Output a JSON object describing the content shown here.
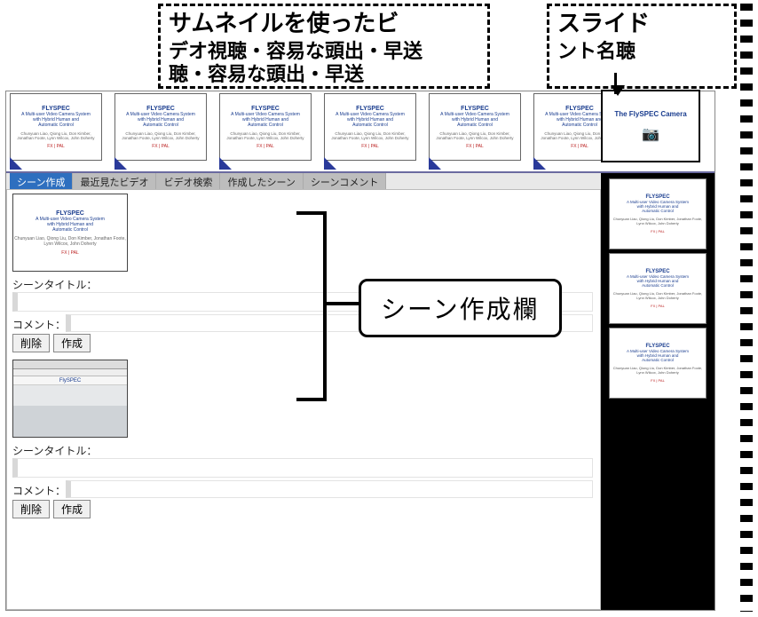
{
  "overlay": {
    "line1": "サムネイルを使ったビ",
    "line2a": "デオ視聴・容易な頭出・早送",
    "line2b": "聴・容易な頭出・早送",
    "right1": "スライド",
    "right2": "ント名聴"
  },
  "callout": {
    "label": "シーン作成欄"
  },
  "tabs": [
    {
      "id": "scene_create",
      "label": "シーン作成"
    },
    {
      "id": "recent_video",
      "label": "最近見たビデオ"
    },
    {
      "id": "video_search",
      "label": "ビデオ検索"
    },
    {
      "id": "created_scene",
      "label": "作成したシーン"
    },
    {
      "id": "scene_comment",
      "label": "シーンコメント"
    }
  ],
  "form": {
    "scene_title_label": "シーンタイトル：",
    "comment_label": "コメント：",
    "delete_btn": "削除",
    "create_btn": "作成"
  },
  "slide_card": {
    "title": "FLYSPEC",
    "sub1": "A Multi-user Video Camera System",
    "sub2": "with Hybrid Human and",
    "sub3": "Automatic Control",
    "meta": "Chunyuan Liao, Qiong Liu, Don Kimber, Jonathan Foote, Lynn Wilcox, John Doherty",
    "logo": "FX | PAL"
  },
  "selected_slide": {
    "title": "The FlySPEC Camera"
  },
  "room_thumb": {
    "brand": "FlySPEC"
  }
}
